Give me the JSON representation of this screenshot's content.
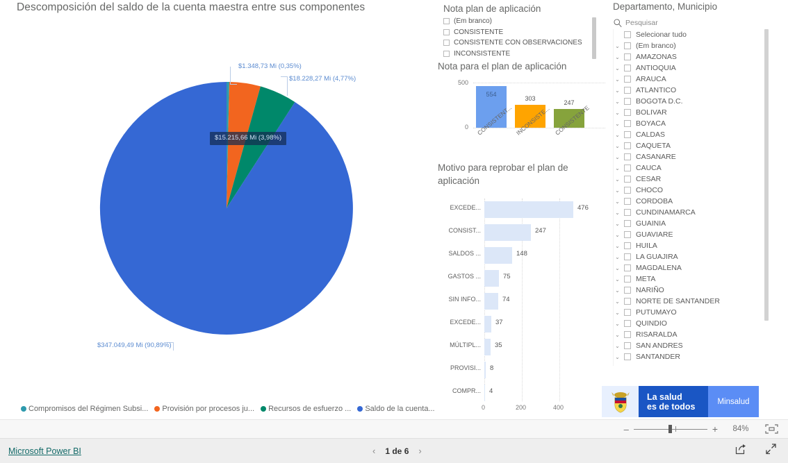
{
  "report": {
    "pie_visual": {
      "title": "Descomposición del saldo de la cuenta maestra entre sus componentes",
      "callouts": {
        "teal": "$1.348,73 Mi (0,35%)",
        "green": "$18.228,27 Mi (4,77%)",
        "orange": "$15.215,66 Mi (3,98%)",
        "blue": "$347.049,49 Mi (90,89%)"
      },
      "legend": [
        {
          "label": "Compromisos del Régimen Subsi...",
          "color": "#2e9aad"
        },
        {
          "label": "Provisión por procesos ju...",
          "color": "#f2651f"
        },
        {
          "label": "Recursos de esfuerzo ...",
          "color": "#00886a"
        },
        {
          "label": "Saldo de la cuenta...",
          "color": "#3568d4"
        }
      ]
    },
    "nota_slicer": {
      "title": "Nota plan de aplicación",
      "items": [
        "(Em branco)",
        "CONSISTENTE",
        "CONSISTENTE CON OBSERVACIONES",
        "INCONSISTENTE"
      ]
    },
    "dept_slicer": {
      "title": "Departamento, Municipio",
      "search_placeholder": "Pesquisar",
      "select_all": "Selecionar tudo",
      "items": [
        "(Em branco)",
        "AMAZONAS",
        "ANTIOQUIA",
        "ARAUCA",
        "ATLANTICO",
        "BOGOTA D.C.",
        "BOLIVAR",
        "BOYACA",
        "CALDAS",
        "CAQUETA",
        "CASANARE",
        "CAUCA",
        "CESAR",
        "CHOCO",
        "CORDOBA",
        "CUNDINAMARCA",
        "GUAINIA",
        "GUAVIARE",
        "HUILA",
        "LA GUAJIRA",
        "MAGDALENA",
        "META",
        "NARIÑO",
        "NORTE DE SANTANDER",
        "PUTUMAYO",
        "QUINDIO",
        "RISARALDA",
        "SAN ANDRES",
        "SANTANDER"
      ]
    },
    "logo": {
      "line1": "La salud",
      "line2": "es de todos",
      "brand": "Minsalud"
    }
  },
  "zoombar": {
    "minus": "–",
    "plus": "+",
    "percent": "84%",
    "fit_icon": "fit-to-page-icon"
  },
  "footer": {
    "powerbi_label": "Microsoft Power BI",
    "page_label": "1 de 6",
    "prev_icon": "chevron-left-icon",
    "next_icon": "chevron-right-icon",
    "share_icon": "share-icon",
    "fullscreen_icon": "fullscreen-icon"
  },
  "chart_data": [
    {
      "type": "pie",
      "title": "Descomposición del saldo de la cuenta maestra entre sus componentes",
      "categories": [
        "Compromisos del Régimen Subsi...",
        "Provisión por procesos ju...",
        "Recursos de esfuerzo ...",
        "Saldo de la cuenta..."
      ],
      "values": [
        1348.73,
        15215.66,
        18228.27,
        347049.49
      ],
      "percents": [
        0.35,
        3.98,
        4.77,
        90.89
      ],
      "value_labels": [
        "$1.348,73 Mi (0,35%)",
        "$15.215,66 Mi (3,98%)",
        "$18.228,27 Mi (4,77%)",
        "$347.049,49 Mi (90,89%)"
      ],
      "colors": [
        "#2e9aad",
        "#f2651f",
        "#00886a",
        "#3568d4"
      ],
      "legend_position": "bottom",
      "units": "Mi"
    },
    {
      "type": "bar",
      "orientation": "vertical",
      "title": "Nota para el plan de aplicación",
      "categories": [
        "CONSISTENT...",
        "INCONSISTE...",
        "CONSISTENTE"
      ],
      "values": [
        554,
        303,
        247
      ],
      "colors": [
        "#6c9fee",
        "#ffa400",
        "#86a33c"
      ],
      "ylim": [
        0,
        600
      ],
      "yticks": [
        0,
        500
      ],
      "ytick_labels": [
        "0",
        "500"
      ],
      "grid": true,
      "xlabel": "",
      "ylabel": ""
    },
    {
      "type": "bar",
      "orientation": "horizontal",
      "title": "Motivo para reprobar el plan de aplicación",
      "categories": [
        "EXCEDE...",
        "CONSIST...",
        "SALDOS ...",
        "GASTOS ...",
        "SIN INFO...",
        "EXCEDE...",
        "MÚLTIPL...",
        "PROVISI...",
        "COMPR..."
      ],
      "values": [
        476,
        247,
        148,
        75,
        74,
        37,
        35,
        8,
        4
      ],
      "bar_color": "#dce7f8",
      "xlim": [
        0,
        560
      ],
      "xticks": [
        0,
        200,
        400
      ],
      "xtick_labels": [
        "0",
        "200",
        "400"
      ],
      "grid": true,
      "xlabel": "",
      "ylabel": ""
    }
  ]
}
